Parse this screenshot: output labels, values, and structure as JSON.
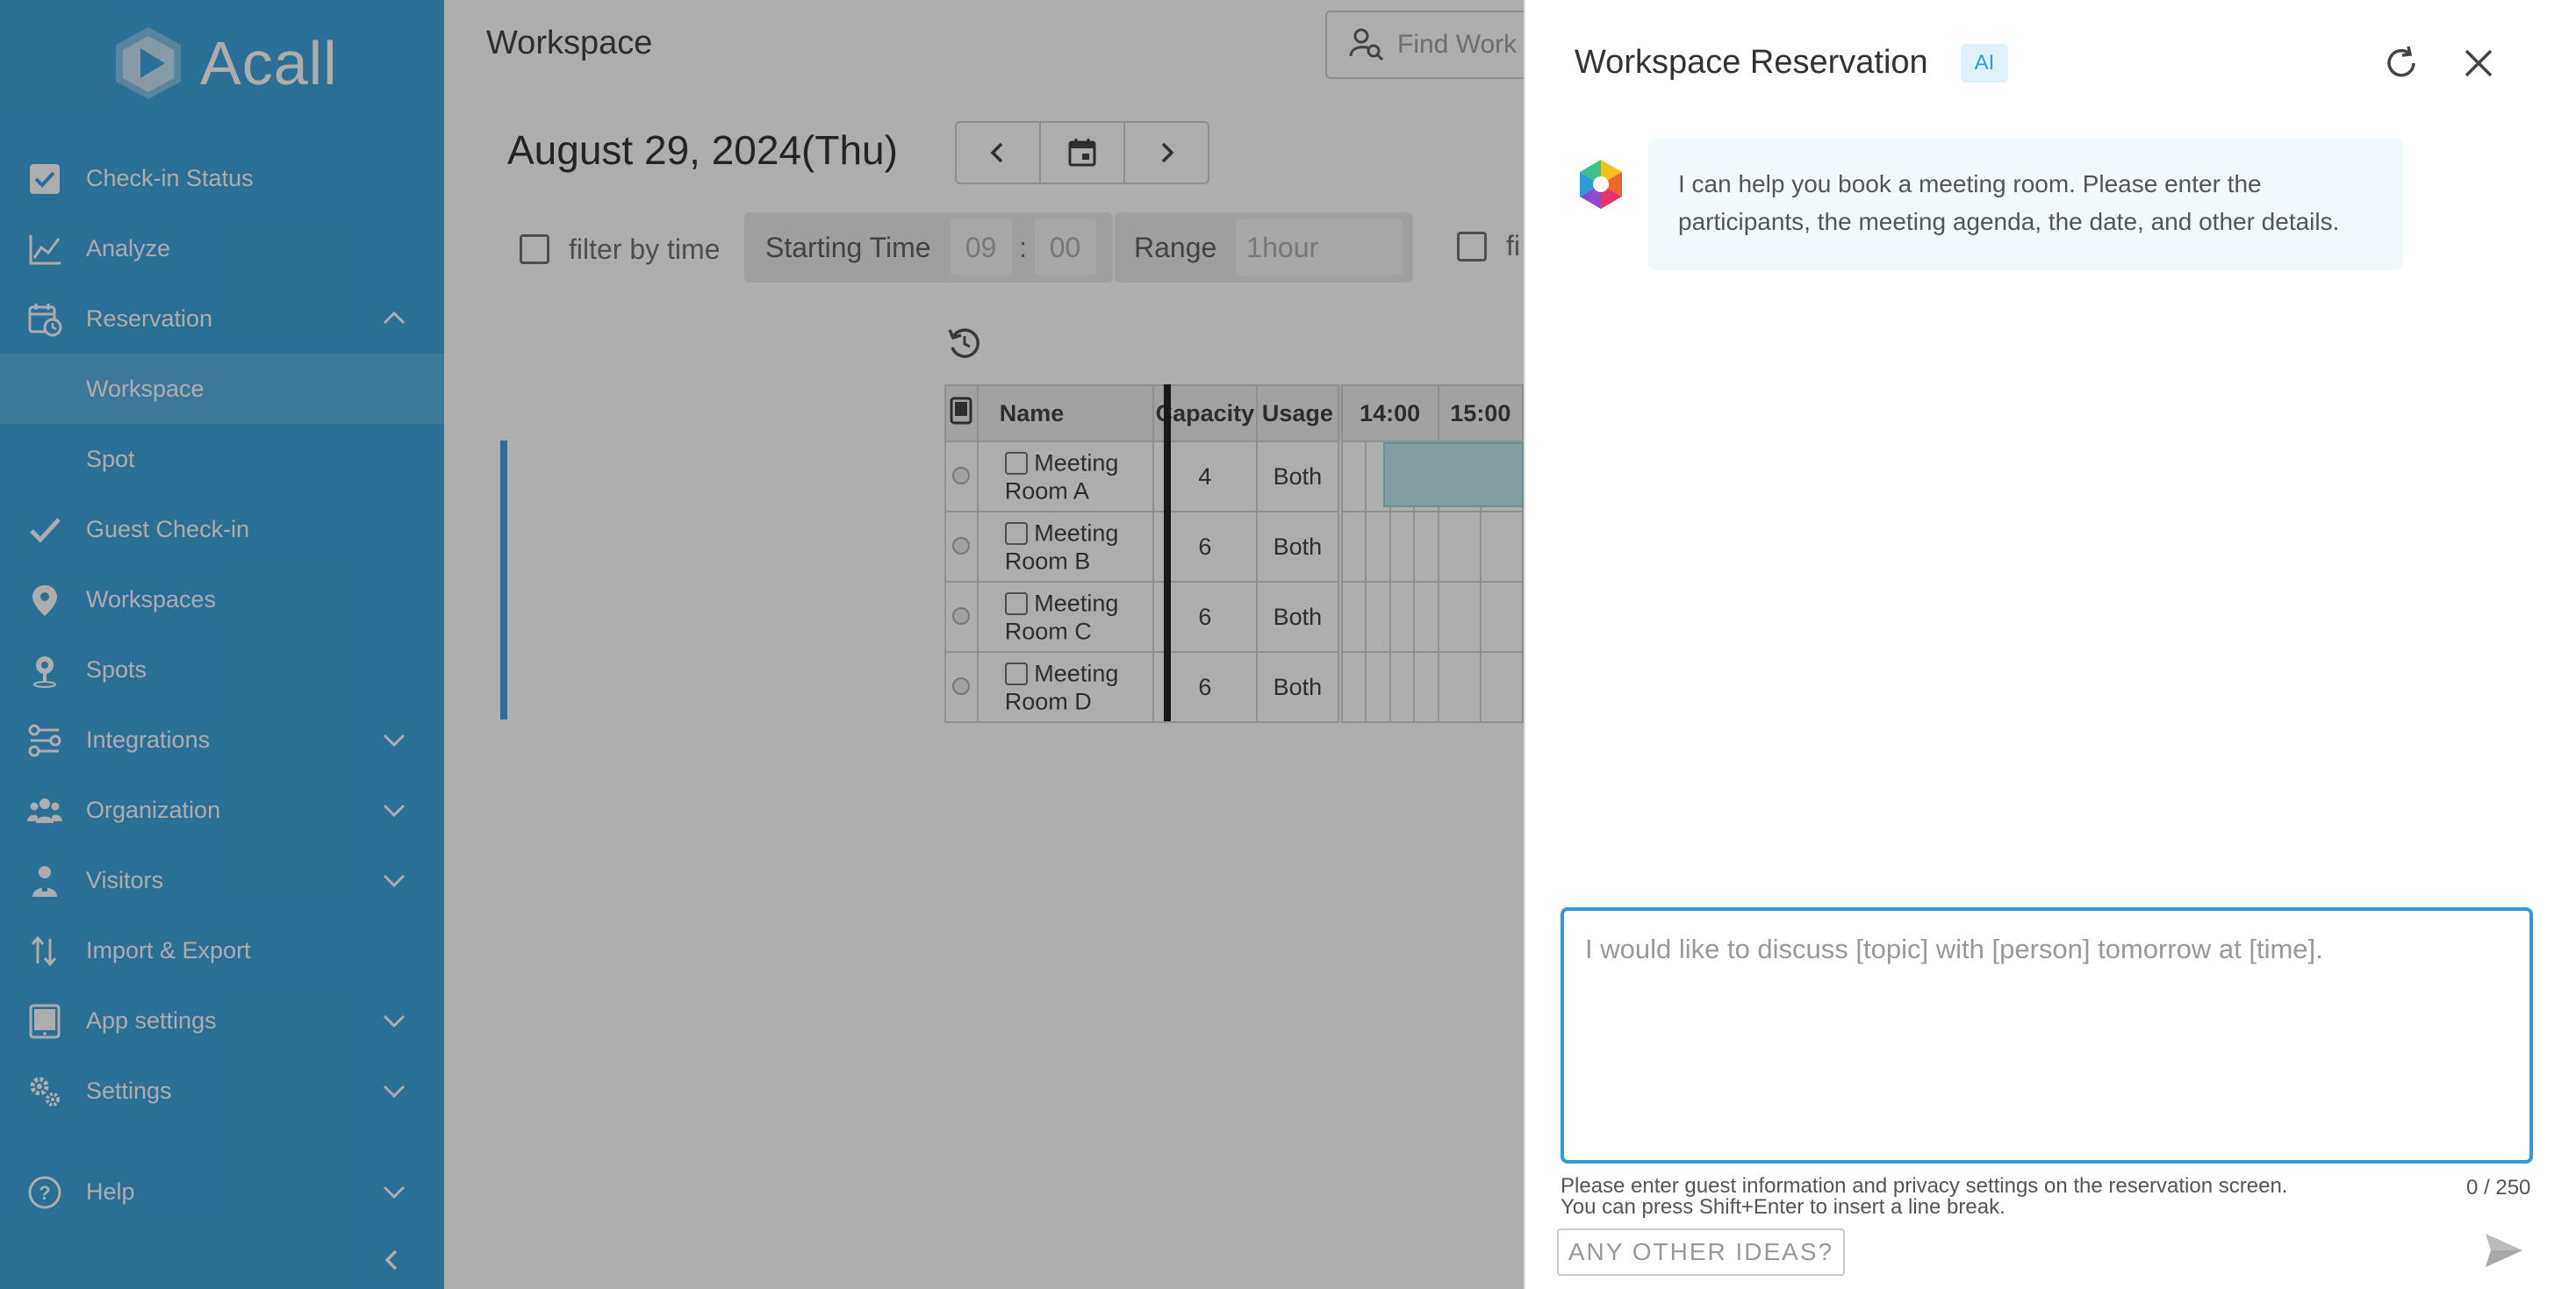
{
  "app": {
    "logo_text": "Acall"
  },
  "sidebar": {
    "items": [
      {
        "label": "Check-in Status",
        "icon": "checkbox-icon"
      },
      {
        "label": "Analyze",
        "icon": "chart-line-icon"
      },
      {
        "label": "Reservation",
        "icon": "calendar-clock-icon",
        "expanded": true
      },
      {
        "label": "Workspace",
        "sub": true,
        "active": true
      },
      {
        "label": "Spot",
        "sub": true
      },
      {
        "label": "Guest Check-in",
        "icon": "check-icon"
      },
      {
        "label": "Workspaces",
        "icon": "map-pin-icon"
      },
      {
        "label": "Spots",
        "icon": "location-pin-icon"
      },
      {
        "label": "Integrations",
        "icon": "integrations-icon",
        "expandable": true
      },
      {
        "label": "Organization",
        "icon": "people-icon",
        "expandable": true
      },
      {
        "label": "Visitors",
        "icon": "visitor-icon",
        "expandable": true
      },
      {
        "label": "Import & Export",
        "icon": "import-export-icon"
      },
      {
        "label": "App settings",
        "icon": "tablet-icon",
        "expandable": true
      },
      {
        "label": "Settings",
        "icon": "gears-icon",
        "expandable": true
      },
      {
        "label": "Help",
        "icon": "help-icon",
        "expandable": true
      }
    ]
  },
  "main": {
    "title": "Workspace",
    "search_placeholder": "Find Work",
    "date": "August 29, 2024(Thu)",
    "filters": {
      "filter_by_time": "filter by time",
      "starting_time_label": "Starting Time",
      "hour": "09",
      "separator": ":",
      "minute": "00",
      "range_label": "Range",
      "range_value": "1hour",
      "second_filter_partial": "fi"
    },
    "table": {
      "headers": [
        "Name",
        "Capacity",
        "Usage",
        "14:00",
        "15:00"
      ],
      "rows": [
        {
          "name": "Meeting Room A",
          "capacity": "4",
          "usage": "Both"
        },
        {
          "name": "Meeting Room B",
          "capacity": "6",
          "usage": "Both"
        },
        {
          "name": "Meeting Room C",
          "capacity": "6",
          "usage": "Both"
        },
        {
          "name": "Meeting Room D",
          "capacity": "6",
          "usage": "Both"
        }
      ]
    }
  },
  "panel": {
    "title": "Workspace Reservation",
    "badge": "AI",
    "bot_message": "I can help you book a meeting room. Please enter the participants, the meeting agenda, the date, and other details.",
    "input_placeholder": "I would like to discuss [topic] with [person] tomorrow at [time].",
    "hint_line1": "Please enter guest information and privacy settings on the reservation screen.",
    "hint_line2": "You can press Shift+Enter to insert a line break.",
    "counter": "0 / 250",
    "ideas_button": "ANY OTHER IDEAS?"
  },
  "colors": {
    "brand": "#2d9bd8",
    "brand_active": "#4aacde",
    "overlay": "rgba(40,40,40,0.38)"
  }
}
